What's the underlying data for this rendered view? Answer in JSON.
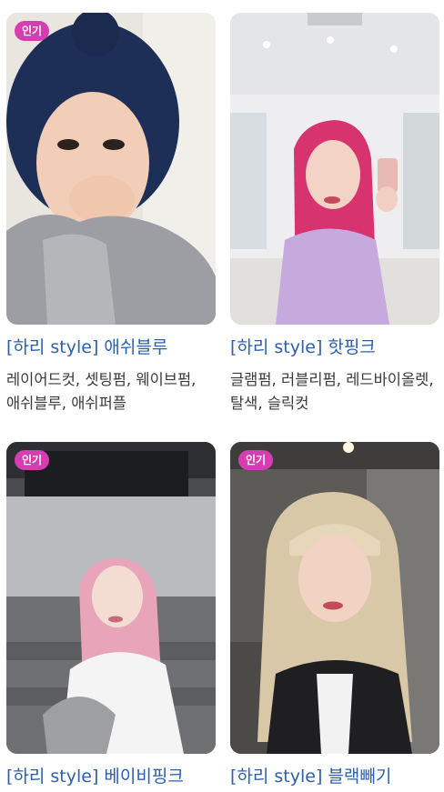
{
  "cards": [
    {
      "badge": "인기",
      "title": "[하리 style] 애쉬블루",
      "tags": "레이어드컷, 셋팅펌, 웨이브펌, 애쉬블루, 애쉬퍼플",
      "hair_color": "#1e2f57"
    },
    {
      "badge": "",
      "title": "[하리 style] 핫핑크",
      "tags": "글램펌, 러블리펌, 레드바이올렛, 탈색, 슬릭컷",
      "hair_color": "#d6336f"
    },
    {
      "badge": "인기",
      "title": "[하리 style] 베이비핑크",
      "tags": "",
      "hair_color": "#e8a4b8"
    },
    {
      "badge": "인기",
      "title": "[하리 style] 블랙빼기",
      "tags": "",
      "hair_color": "#d9c8a8"
    }
  ],
  "colors": {
    "badge_bg": "#d63db1",
    "title_text": "#2a5fb0",
    "tag_text": "#3a3a3a"
  }
}
